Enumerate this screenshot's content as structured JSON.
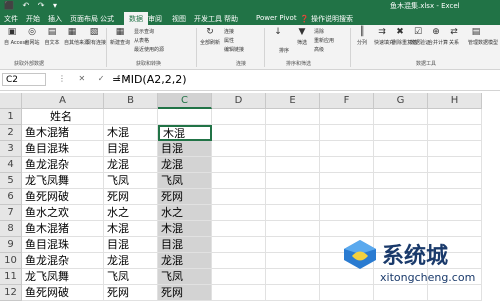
{
  "title_bar": {
    "quick_access": "⬛ ↶ ↷ ▾",
    "document_title": "鱼木混集.xlsx - Excel"
  },
  "tabs": [
    {
      "label": "文件",
      "active": false
    },
    {
      "label": "开始",
      "active": false
    },
    {
      "label": "插入",
      "active": false
    },
    {
      "label": "页面布局",
      "active": false
    },
    {
      "label": "公式",
      "active": false
    },
    {
      "label": "数据",
      "active": true
    },
    {
      "label": "审阅",
      "active": false
    },
    {
      "label": "视图",
      "active": false
    },
    {
      "label": "开发工具",
      "active": false
    },
    {
      "label": "帮助",
      "active": false
    },
    {
      "label": "Power Pivot",
      "active": false
    },
    {
      "label": "❓ 操作说明搜索",
      "active": false
    }
  ],
  "ribbon": {
    "get_external": [
      "自 Access",
      "自网站",
      "自文本",
      "自其他来源",
      "现有连接"
    ],
    "get_external_label": "获取外部数据",
    "new_query": "新建查询",
    "transform_small": [
      "显示查询",
      "从表格",
      "最近使用的源"
    ],
    "transform_label": "获取和转换",
    "refresh_all": "全部刷新",
    "connections_small": [
      "连接",
      "属性",
      "编辑链接"
    ],
    "connections_label": "连接",
    "sort": "排序",
    "filter": "筛选",
    "filter_small": [
      "清除",
      "重新应用",
      "高级"
    ],
    "sort_label": "排序和筛选",
    "data_tools": [
      "分列",
      "快速填充",
      "删除重复值",
      "数据验证",
      "合并计算",
      "关系",
      "管理数据模型"
    ],
    "data_tools_label": "数据工具"
  },
  "formula_bar": {
    "name_box": "C2",
    "icons": "⋮ ✕ ✓ fx",
    "formula": "=MID(A2,2,2)"
  },
  "columns": [
    "A",
    "B",
    "C",
    "D",
    "E",
    "F",
    "G",
    "H"
  ],
  "rows": [
    [
      "姓名",
      "",
      ""
    ],
    [
      "鱼木混猪",
      "木混",
      "木混"
    ],
    [
      "鱼目混珠",
      "目混",
      "目混"
    ],
    [
      "鱼龙混杂",
      "龙混",
      "龙混"
    ],
    [
      "龙飞凤舞",
      "飞凤",
      "飞凤"
    ],
    [
      "鱼死网破",
      "死网",
      "死网"
    ],
    [
      "鱼水之欢",
      "水之",
      "水之"
    ],
    [
      "鱼木混猪",
      "木混",
      "木混"
    ],
    [
      "鱼目混珠",
      "目混",
      "目混"
    ],
    [
      "鱼龙混杂",
      "龙混",
      "龙混"
    ],
    [
      "龙飞凤舞",
      "飞凤",
      "飞凤"
    ],
    [
      "鱼死网破",
      "死网",
      "死网"
    ]
  ],
  "active_cell": "C2",
  "selected_column": "C",
  "watermark": {
    "title": "系统城",
    "url": "xitongcheng.com"
  },
  "colors": {
    "excel_green": "#217346",
    "selection_gray": "#d3d3d3",
    "watermark_blue": "#1a3a6b"
  }
}
